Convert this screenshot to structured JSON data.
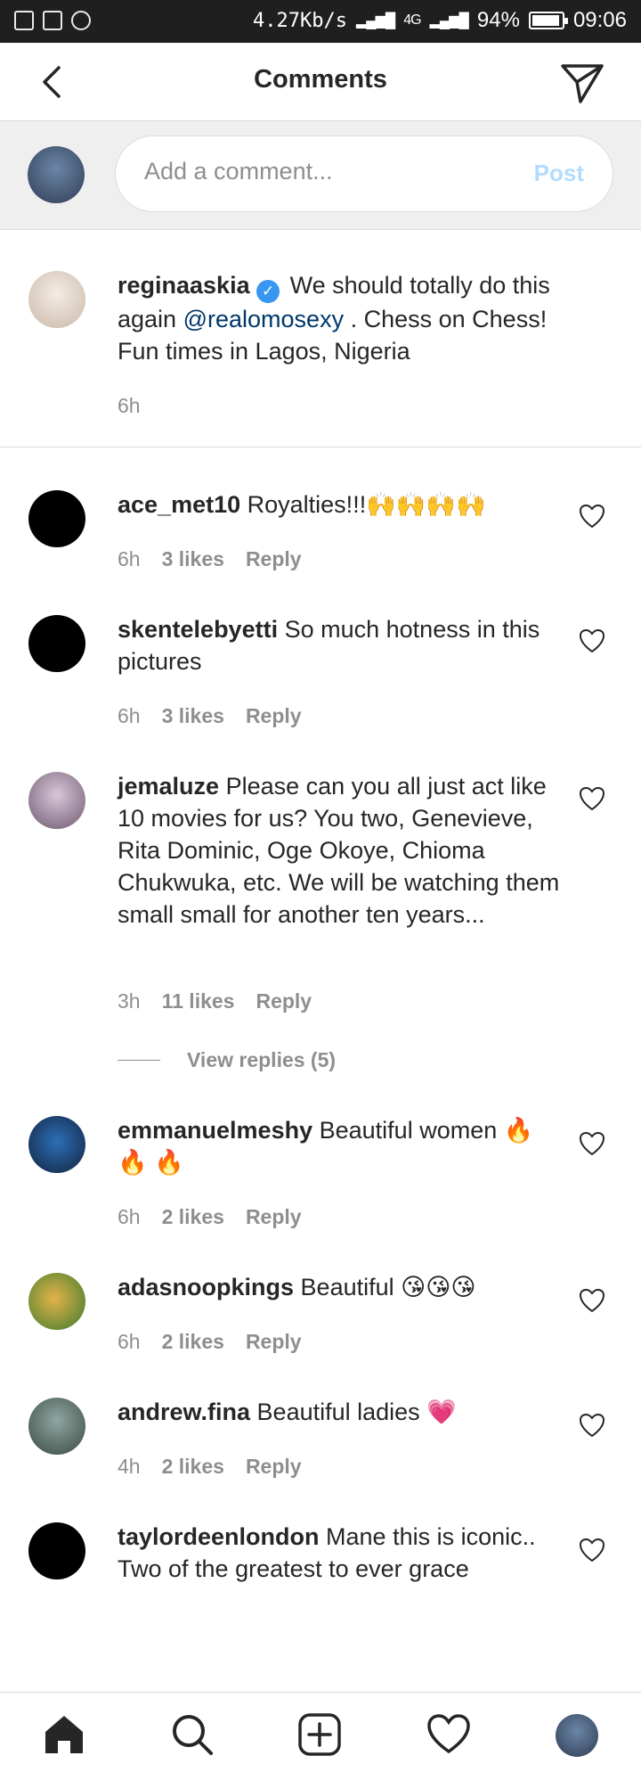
{
  "status_bar": {
    "speed": "4.27Kb/s",
    "network": "4G",
    "battery": "94%",
    "battery_level": 0.94,
    "time": "09:06"
  },
  "header": {
    "title": "Comments",
    "back_icon": "chevron-left-icon",
    "send_icon": "paper-plane-icon"
  },
  "compose": {
    "placeholder": "Add a comment...",
    "post_label": "Post"
  },
  "caption": {
    "username": "reginaaskia",
    "verified": true,
    "text_before": "We should totally do this again",
    "mention": "@realomosexy",
    "text_after": ". Chess on Chess! Fun times in Lagos, Nigeria",
    "time": "6h"
  },
  "comments": [
    {
      "username": "ace_met10",
      "text": "Royalties!!!🙌🙌🙌🙌",
      "time": "6h",
      "likes": "3 likes",
      "reply": "Reply"
    },
    {
      "username": "skentelebyetti",
      "text": "So much hotness in this pictures",
      "time": "6h",
      "likes": "3 likes",
      "reply": "Reply"
    },
    {
      "username": "jemaluze",
      "text": "Please can you all just act like 10 movies for us? You two, Genevieve, Rita Dominic, Oge Okoye, Chioma Chukwuka, etc. We will be watching them small small for another ten years...",
      "time": "3h",
      "likes": "11 likes",
      "reply": "Reply",
      "view_replies": "View replies (5)"
    },
    {
      "username": "emmanuelmeshy",
      "text": "Beautiful women 🔥 🔥 🔥",
      "time": "6h",
      "likes": "2 likes",
      "reply": "Reply"
    },
    {
      "username": "adasnoopkings",
      "text": "Beautiful 😘😘😘",
      "time": "6h",
      "likes": "2 likes",
      "reply": "Reply"
    },
    {
      "username": "andrew.fina",
      "text": "Beautiful ladies 💗",
      "time": "4h",
      "likes": "2 likes",
      "reply": "Reply"
    },
    {
      "username": "taylordeenlondon",
      "text": "Mane this is iconic.. Two of the greatest to ever grace",
      "time": "",
      "likes": "",
      "reply": ""
    }
  ],
  "nav": {
    "items": [
      "home-icon",
      "search-icon",
      "new-post-icon",
      "activity-heart-icon",
      "profile-avatar"
    ]
  }
}
